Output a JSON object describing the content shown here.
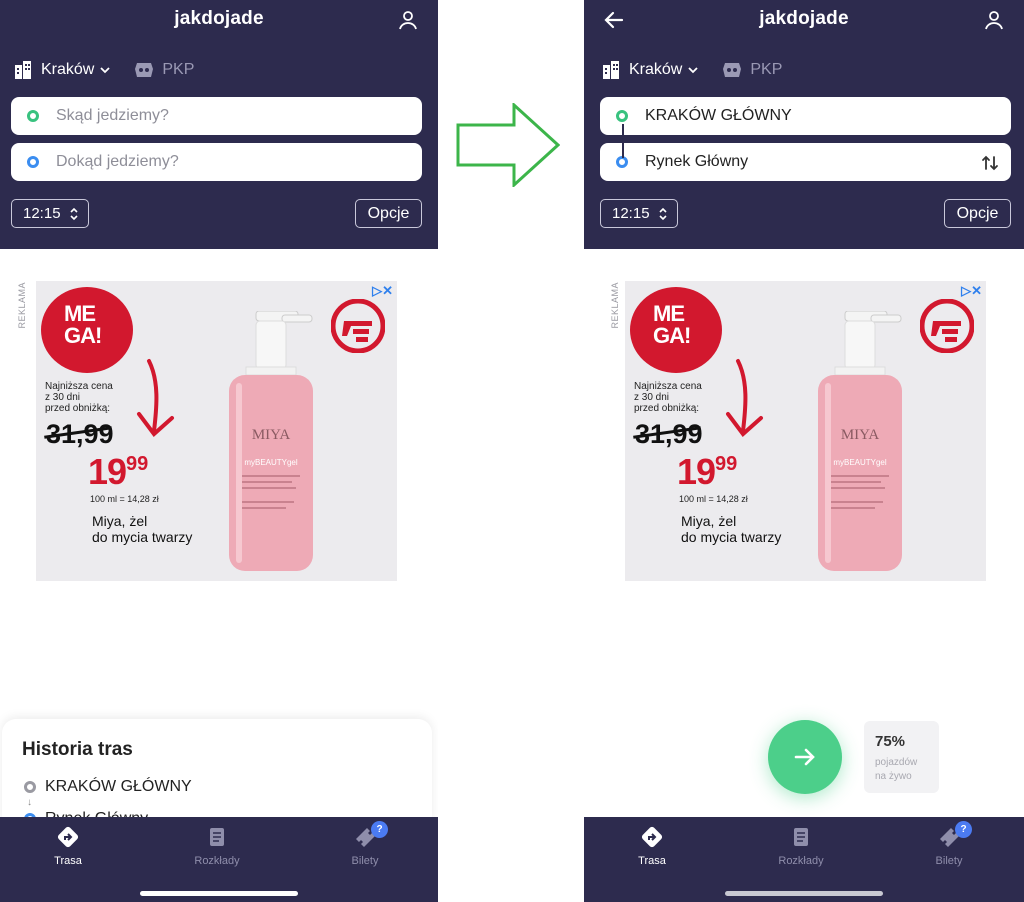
{
  "app": {
    "title": "jakdojade"
  },
  "left_screen": {
    "city": "Kraków",
    "pkp": "PKP",
    "from_placeholder": "Skąd jedziemy?",
    "to_placeholder": "Dokąd jedziemy?",
    "time": "12:15",
    "options": "Opcje",
    "history": {
      "title": "Historia tras",
      "items": [
        "KRAKÓW GŁÓWNY",
        "Rynek Główny"
      ]
    }
  },
  "right_screen": {
    "city": "Kraków",
    "pkp": "PKP",
    "from_value": "KRAKÓW GŁÓWNY",
    "to_value": "Rynek Główny",
    "time": "12:15",
    "options": "Opcje",
    "live": {
      "percent": "75%",
      "line1": "pojazdów",
      "line2": "na żywo"
    }
  },
  "ad": {
    "label": "REKLAMA",
    "badge_line1": "ME",
    "badge_line2": "GA!",
    "small_text": [
      "Najniższa cena",
      "z 30 dni",
      "przed obniżką:"
    ],
    "old_price": "31,99",
    "new_price_main": "19",
    "new_price_cents": "99",
    "unit_price": "100 ml = 14,28 zł",
    "product_line1": "Miya, żel",
    "product_line2": "do mycia twarzy",
    "bottle_brand": "MIYA",
    "bottle_product": "myBEAUTYgel",
    "choice_icon": "ad-choices-icon"
  },
  "tabs": [
    {
      "label": "Trasa",
      "icon": "route-icon",
      "active": true
    },
    {
      "label": "Rozkłady",
      "icon": "timetable-icon",
      "active": false
    },
    {
      "label": "Bilety",
      "icon": "ticket-icon",
      "active": false,
      "badge": "?"
    }
  ],
  "colors": {
    "header": "#2d2b4e",
    "accent_green": "#4ccf8a",
    "dot_blue": "#3b8df0",
    "brand_red": "#d2182e",
    "transition_arrow": "#3cb54a"
  }
}
